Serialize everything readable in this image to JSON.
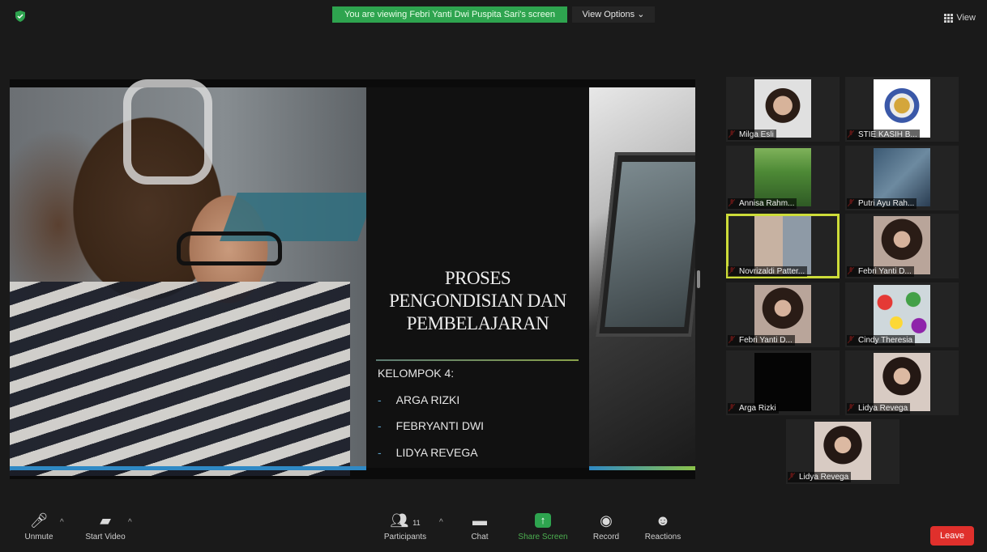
{
  "topbar": {
    "viewing_banner": "You are viewing Febri Yanti Dwi Puspita Sari's screen",
    "view_options": "View Options",
    "view_label": "View"
  },
  "slide": {
    "title_lines": [
      "PROSES",
      "PENGONDISIAN DAN",
      "PEMBELAJARAN"
    ],
    "group_label": "KELOMPOK 4:",
    "members": [
      "ARGA RIZKI",
      "FEBRYANTI DWI",
      "LIDYA REVEGA"
    ],
    "bullet": "-"
  },
  "participants": [
    {
      "name": "Milga Esli",
      "thumb": "face",
      "active": false
    },
    {
      "name": "STIE KASIH B...",
      "thumb": "logo",
      "active": false
    },
    {
      "name": "Annisa Rahm...",
      "thumb": "tea",
      "active": false
    },
    {
      "name": "Putri Ayu Rah...",
      "thumb": "shoe",
      "active": false
    },
    {
      "name": "Novrizaldi Patter...",
      "thumb": "duo",
      "active": true
    },
    {
      "name": "Febri Yanti D...",
      "thumb": "girl",
      "active": false
    },
    {
      "name": "Febri Yanti D...",
      "thumb": "girl",
      "active": false
    },
    {
      "name": "Cindy Theresia",
      "thumb": "balloon",
      "active": false
    },
    {
      "name": "Arga Rizki",
      "thumb": "black",
      "active": false
    },
    {
      "name": "Lidya Revega",
      "thumb": "lidya",
      "active": false
    },
    {
      "name": "Lidya Revega",
      "thumb": "lidya",
      "active": false
    }
  ],
  "toolbar": {
    "unmute": "Unmute",
    "start_video": "Start Video",
    "participants": "Participants",
    "participant_count": "11",
    "chat": "Chat",
    "share_screen": "Share Screen",
    "record": "Record",
    "reactions": "Reactions",
    "leave": "Leave"
  },
  "colors": {
    "banner_green": "#2ea44f",
    "active_speaker": "#cddc39",
    "leave_red": "#e0302c",
    "share_green": "#4caf50"
  }
}
